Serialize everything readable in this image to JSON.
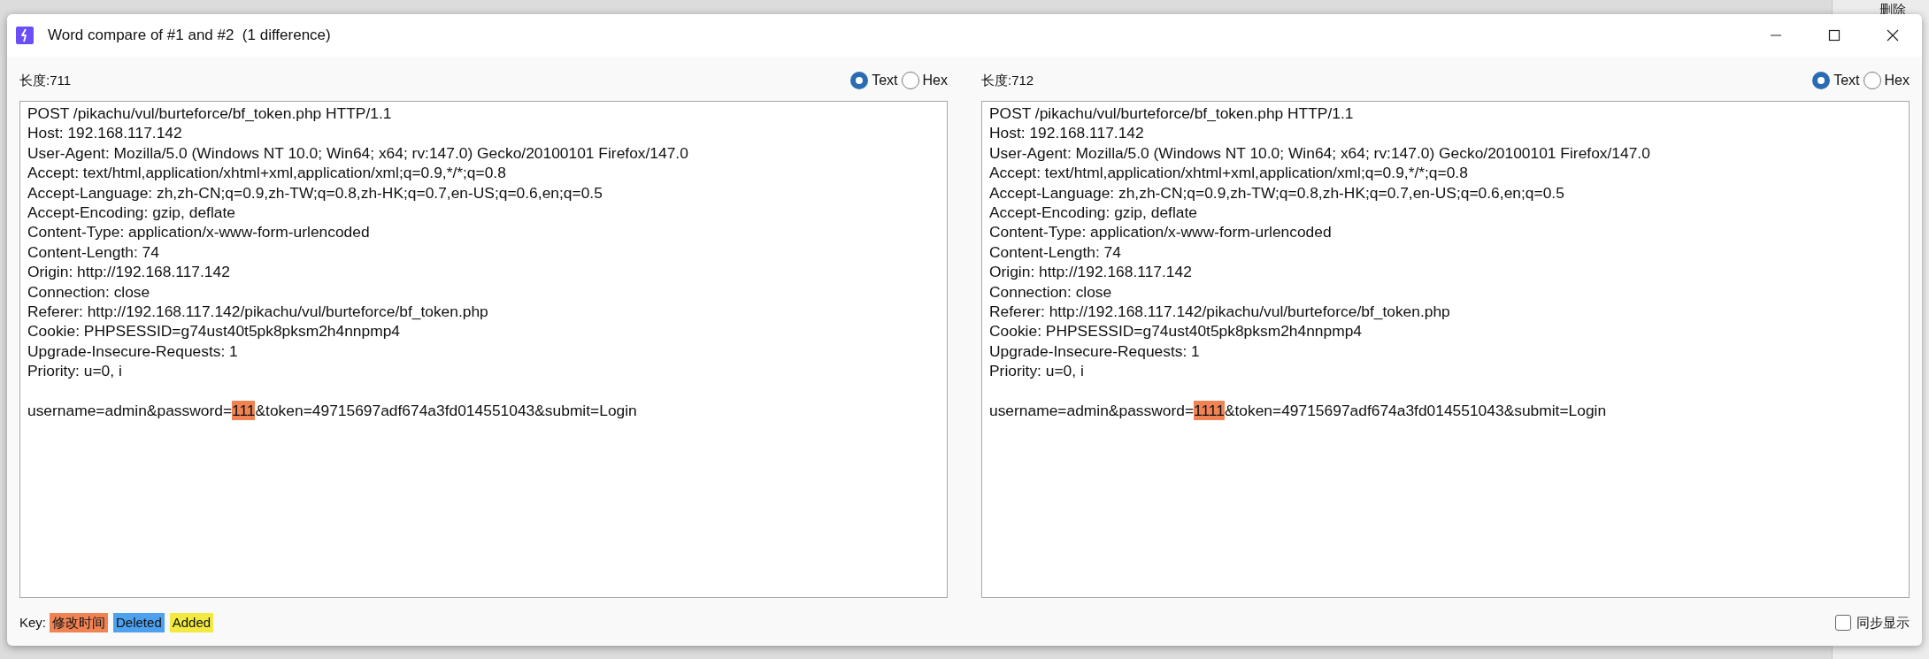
{
  "background": {
    "button_label": "删除"
  },
  "window": {
    "title": "Word compare of #1 and #2  (1 difference)"
  },
  "panels": [
    {
      "length_label": "长度:711",
      "view_modes": [
        {
          "label": "Text",
          "selected": true
        },
        {
          "label": "Hex",
          "selected": false
        }
      ],
      "lines": [
        {
          "text": "POST /pikachu/vul/burteforce/bf_token.php HTTP/1.1"
        },
        {
          "text": "Host: 192.168.117.142"
        },
        {
          "text": "User-Agent: Mozilla/5.0 (Windows NT 10.0; Win64; x64; rv:147.0) Gecko/20100101 Firefox/147.0"
        },
        {
          "text": "Accept: text/html,application/xhtml+xml,application/xml;q=0.9,*/*;q=0.8"
        },
        {
          "text": "Accept-Language: zh,zh-CN;q=0.9,zh-TW;q=0.8,zh-HK;q=0.7,en-US;q=0.6,en;q=0.5"
        },
        {
          "text": "Accept-Encoding: gzip, deflate"
        },
        {
          "text": "Content-Type: application/x-www-form-urlencoded"
        },
        {
          "text": "Content-Length: 74"
        },
        {
          "text": "Origin: http://192.168.117.142"
        },
        {
          "text": "Connection: close"
        },
        {
          "text": "Referer: http://192.168.117.142/pikachu/vul/burteforce/bf_token.php"
        },
        {
          "text": "Cookie: PHPSESSID=g74ust40t5pk8pksm2h4nnpmp4"
        },
        {
          "text": "Upgrade-Insecure-Requests: 1"
        },
        {
          "text": "Priority: u=0, i"
        },
        {
          "blank_before": true,
          "parts": [
            {
              "text": "username=admin&password=",
              "modified": false
            },
            {
              "text": "111",
              "modified": true
            },
            {
              "text": "&token=49715697adf674a3fd014551043&submit=Login",
              "modified": false
            }
          ]
        }
      ]
    },
    {
      "length_label": "长度:712",
      "view_modes": [
        {
          "label": "Text",
          "selected": true
        },
        {
          "label": "Hex",
          "selected": false
        }
      ],
      "lines": [
        {
          "text": "POST /pikachu/vul/burteforce/bf_token.php HTTP/1.1"
        },
        {
          "text": "Host: 192.168.117.142"
        },
        {
          "text": "User-Agent: Mozilla/5.0 (Windows NT 10.0; Win64; x64; rv:147.0) Gecko/20100101 Firefox/147.0"
        },
        {
          "text": "Accept: text/html,application/xhtml+xml,application/xml;q=0.9,*/*;q=0.8"
        },
        {
          "text": "Accept-Language: zh,zh-CN;q=0.9,zh-TW;q=0.8,zh-HK;q=0.7,en-US;q=0.6,en;q=0.5"
        },
        {
          "text": "Accept-Encoding: gzip, deflate"
        },
        {
          "text": "Content-Type: application/x-www-form-urlencoded"
        },
        {
          "text": "Content-Length: 74"
        },
        {
          "text": "Origin: http://192.168.117.142"
        },
        {
          "text": "Connection: close"
        },
        {
          "text": "Referer: http://192.168.117.142/pikachu/vul/burteforce/bf_token.php"
        },
        {
          "text": "Cookie: PHPSESSID=g74ust40t5pk8pksm2h4nnpmp4"
        },
        {
          "text": "Upgrade-Insecure-Requests: 1"
        },
        {
          "text": "Priority: u=0, i"
        },
        {
          "blank_before": true,
          "parts": [
            {
              "text": "username=admin&password=",
              "modified": false
            },
            {
              "text": "1111",
              "modified": true
            },
            {
              "text": "&token=49715697adf674a3fd014551043&submit=Login",
              "modified": false
            }
          ]
        }
      ]
    }
  ],
  "key": {
    "label": "Key:",
    "items": [
      {
        "label": "修改时间",
        "color": "#ef8354"
      },
      {
        "label": "Deleted",
        "color": "#4ea1ee"
      },
      {
        "label": "Added",
        "color": "#f2ea42"
      }
    ]
  },
  "sync": {
    "label": "同步显示",
    "checked": false
  }
}
